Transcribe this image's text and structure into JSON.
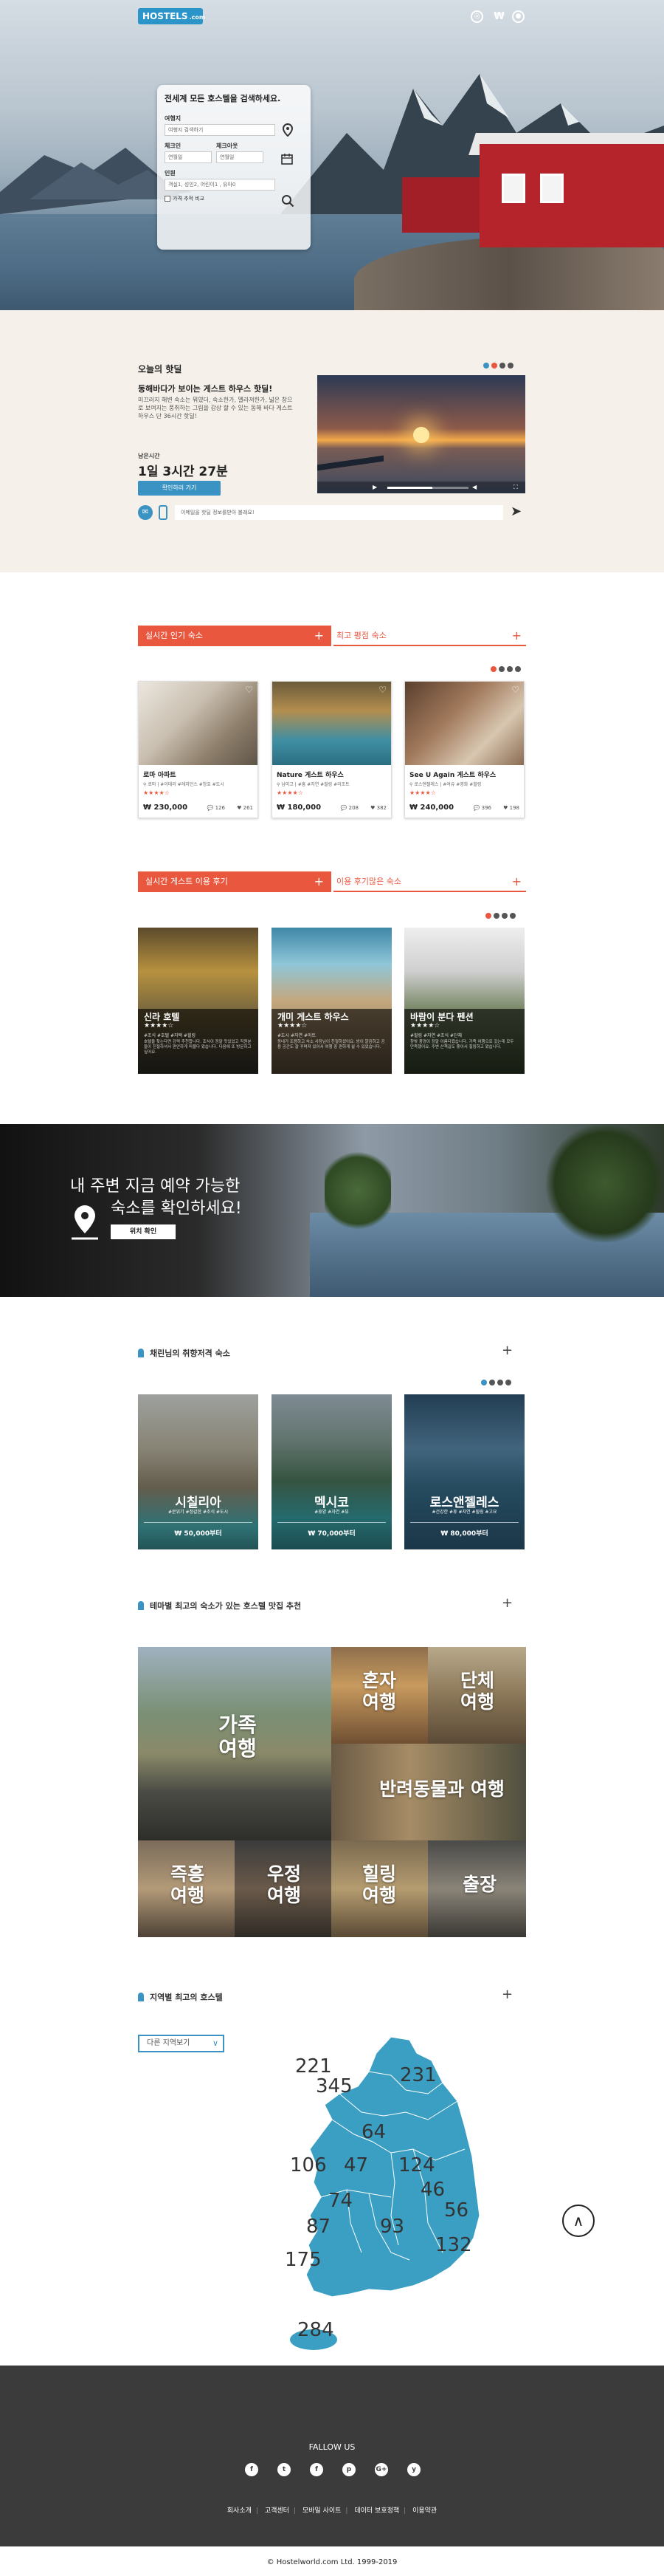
{
  "header": {
    "logo_text": "HOSTELS",
    "logo_suffix": ".com",
    "icons": [
      "globe-icon",
      "won-currency-icon",
      "user-icon"
    ],
    "currency_glyph": "₩"
  },
  "search": {
    "title": "전세계 모든 호스텔을 검색하세요.",
    "destination_label": "여행지",
    "destination_placeholder": "여행지 검색하기",
    "checkin_label": "체크인",
    "checkout_label": "체크아웃",
    "checkin_value": "연월일",
    "checkout_value": "연월일",
    "guests_label": "인원",
    "guests_value": "객실1, 성인2, 어린이1 , 유아0",
    "compare_label": "가격 추적 비교"
  },
  "deal": {
    "title": "오늘의 핫딜",
    "subtitle": "동해바다가 보이는 게스트 하우스 핫딜!",
    "description": "미끄러지 해변 숙소는 뭐였더, 숙소한가, 멜라져한가, 넓은 창으로 보여지는 풍취하는 그림을 감상 할 수 있는 동해 바다 게스트 하우스 단 36시간 핫딜!",
    "remaining_label": "남은시간",
    "timer": "1일 3시간 27분",
    "button": "확인하러 가기",
    "share_placeholder": "이메일을 핫딜 정보를받아 볼래요!",
    "dot_colors": [
      "#3a93c2",
      "#e9573f",
      "#555555",
      "#555555"
    ],
    "video_progress": 0.55
  },
  "popular": {
    "tab_active": "실시간 인기 숙소",
    "tab_inactive": "최고 평점 숙소",
    "dot_colors": [
      "#e9573f",
      "#555555",
      "#555555",
      "#555555"
    ],
    "cards": [
      {
        "name": "로마 아파트",
        "loc": "로마 | #이태리 #레지던스 #창호 #도시",
        "stars": "★★★★☆",
        "price": "₩ 230,000",
        "comments": "126",
        "likes": "261"
      },
      {
        "name": "Nature 게스트 하우스",
        "loc": "남미고 | #흥 #자연 #힐링 #리조트",
        "stars": "★★★★☆",
        "price": "₩ 180,000",
        "comments": "208",
        "likes": "382"
      },
      {
        "name": "See U Again 게스트 하우스",
        "loc": "로스엔젤레스 | #여유 #영화 #힐링",
        "stars": "★★★★☆",
        "price": "₩ 240,000",
        "comments": "396",
        "likes": "198"
      }
    ]
  },
  "reviews": {
    "tab_active": "실시간 게스트 이용 후기",
    "tab_inactive": "이용 후기많은 숙소",
    "dot_colors": [
      "#e9573f",
      "#555555",
      "#555555",
      "#555555"
    ],
    "cards": [
      {
        "name": "신라 호텔",
        "stars": "★★★★☆",
        "tags": "#조식 #호텔 #자택 #힐링",
        "text": "호텔을 찾는다면 강력 추천합니다. 조식이 정말 맛있었고 직원분들이 친절하셔서 편안하게 머물다 왔습니다. 다음에 또 방문하고 싶어요."
      },
      {
        "name": "개미 게스트 하우스",
        "stars": "★★★★☆",
        "tags": "#도시 #자연 #아트",
        "text": "동네가 조용하고 숙소 사장님이 친절하셨어요. 방이 깔끔하고 공용 공간도 잘 꾸며져 있어서 여행 중 편하게 쉴 수 있었습니다."
      },
      {
        "name": "바람이 분다 펜션",
        "stars": "★★★★☆",
        "tags": "#힐링 #자연 #조식 #단체",
        "text": "창밖 풍경이 정말 아름다웠습니다. 가족 여행으로 갔는데 모두 만족했어요. 주변 산책길도 좋아서 힐링하고 왔습니다."
      }
    ]
  },
  "banner": {
    "line1": "내 주변 지금 예약 가능한",
    "line2": "숙소를 확인하세요!",
    "button": "위치 확인"
  },
  "taste": {
    "title": "채린님의 취향저격 숙소",
    "dot_colors": [
      "#3a93c2",
      "#555555",
      "#555555",
      "#555555"
    ],
    "cities": [
      {
        "name": "시칠리아",
        "tags": "#분위기 #정갈한 #조식 #도시",
        "price": "₩ 50,000부터"
      },
      {
        "name": "멕시코",
        "tags": "#휴양 #자연 #뷰",
        "price": "₩ 70,000부터"
      },
      {
        "name": "로스앤젤레스",
        "tags": "#건강한 #휴 #자연 #힐링 #고요",
        "price": "₩ 80,000부터"
      }
    ]
  },
  "themes": {
    "title": "테마별 최고의 숙소가 있는 호스텔 맛집 추천",
    "items": [
      "가족 여행",
      "혼자 여행",
      "단체 여행",
      "반려동물과 여행",
      "즉흥 여행",
      "우정 여행",
      "힐링 여행",
      "출장"
    ]
  },
  "regions": {
    "title": "지역별 최고의 호스텔",
    "select_label": "다른 지역보기",
    "counts": [
      "221",
      "345",
      "231",
      "64",
      "106",
      "47",
      "124",
      "46",
      "74",
      "56",
      "87",
      "93",
      "132",
      "175",
      "284"
    ],
    "map_color": "#3a9fc3"
  },
  "footer": {
    "follow": "FALLOW US",
    "social": [
      "f",
      "t",
      "f",
      "p",
      "G+",
      "y"
    ],
    "links": [
      "회사소개",
      "고객센터",
      "모바일 사이트",
      "데이터 보호정책",
      "이용약관"
    ],
    "copyright": "© Hostelworld.com Ltd. 1999-2019"
  }
}
